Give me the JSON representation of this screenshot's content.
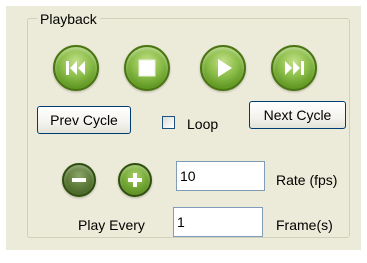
{
  "playback": {
    "group_title": "Playback",
    "media_buttons": [
      {
        "name": "prev",
        "icon": "skip-back-icon"
      },
      {
        "name": "stop",
        "icon": "stop-icon"
      },
      {
        "name": "play",
        "icon": "play-icon"
      },
      {
        "name": "next",
        "icon": "skip-forward-icon"
      }
    ],
    "prev_cycle_label": "Prev Cycle",
    "next_cycle_label": "Next Cycle",
    "loop_label": "Loop",
    "loop_checked": false,
    "rate_value": "10",
    "rate_label": "Rate (fps)",
    "play_every_label": "Play Every",
    "play_every_value": "1",
    "frames_label": "Frame(s)"
  },
  "colors": {
    "panel_bg": "#ecead8",
    "button_green": "#73a735",
    "dark_green": "#3b561c",
    "input_border": "#7f9db9",
    "button_border": "#003c74"
  }
}
